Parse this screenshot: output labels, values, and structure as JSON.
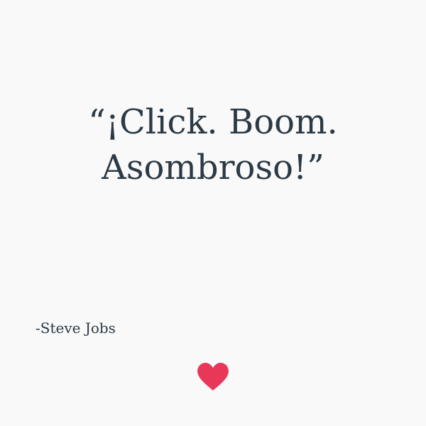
{
  "quote": {
    "line1": "“¡Click. Boom.",
    "line2": "Asombroso!”"
  },
  "author": "-Steve Jobs",
  "like": {
    "icon": "heart-icon",
    "color": "#e8385a"
  }
}
